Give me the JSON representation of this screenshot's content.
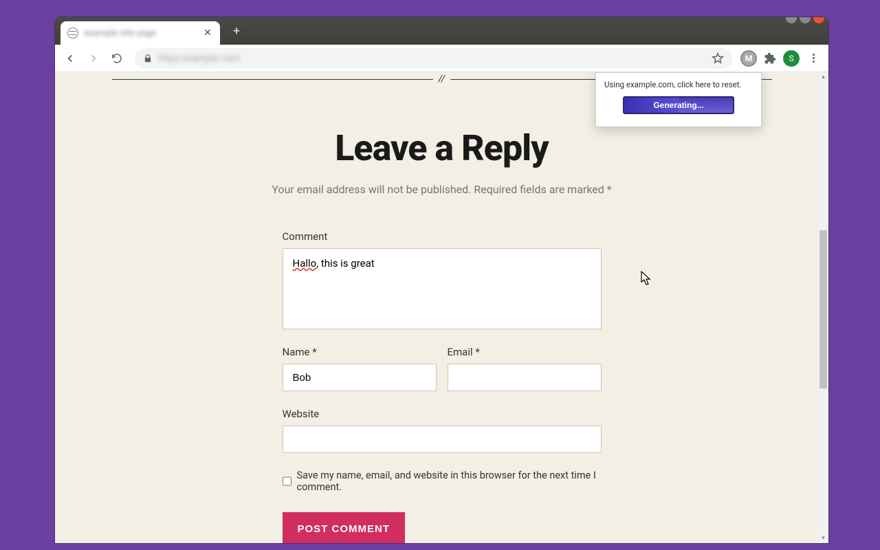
{
  "window": {
    "tab_title": "example site page",
    "minimize": "-",
    "maximize": "□",
    "close": "×"
  },
  "toolbar": {
    "url": "https example com",
    "ext_letter": "M",
    "avatar_letter": "S"
  },
  "popup": {
    "text": "Using example.com, click here to reset.",
    "button": "Generating..."
  },
  "page": {
    "divider": "//",
    "title": "Leave a Reply",
    "note": "Your email address will not be published. Required fields are marked *",
    "comment_label": "Comment",
    "comment_word_underlined": "Hallo",
    "comment_rest": ", this is great",
    "name_label": "Name *",
    "name_value": "Bob",
    "email_label": "Email *",
    "email_value": "",
    "website_label": "Website",
    "website_value": "",
    "save_label": "Save my name, email, and website in this browser for the next time I comment.",
    "submit": "POST COMMENT"
  }
}
